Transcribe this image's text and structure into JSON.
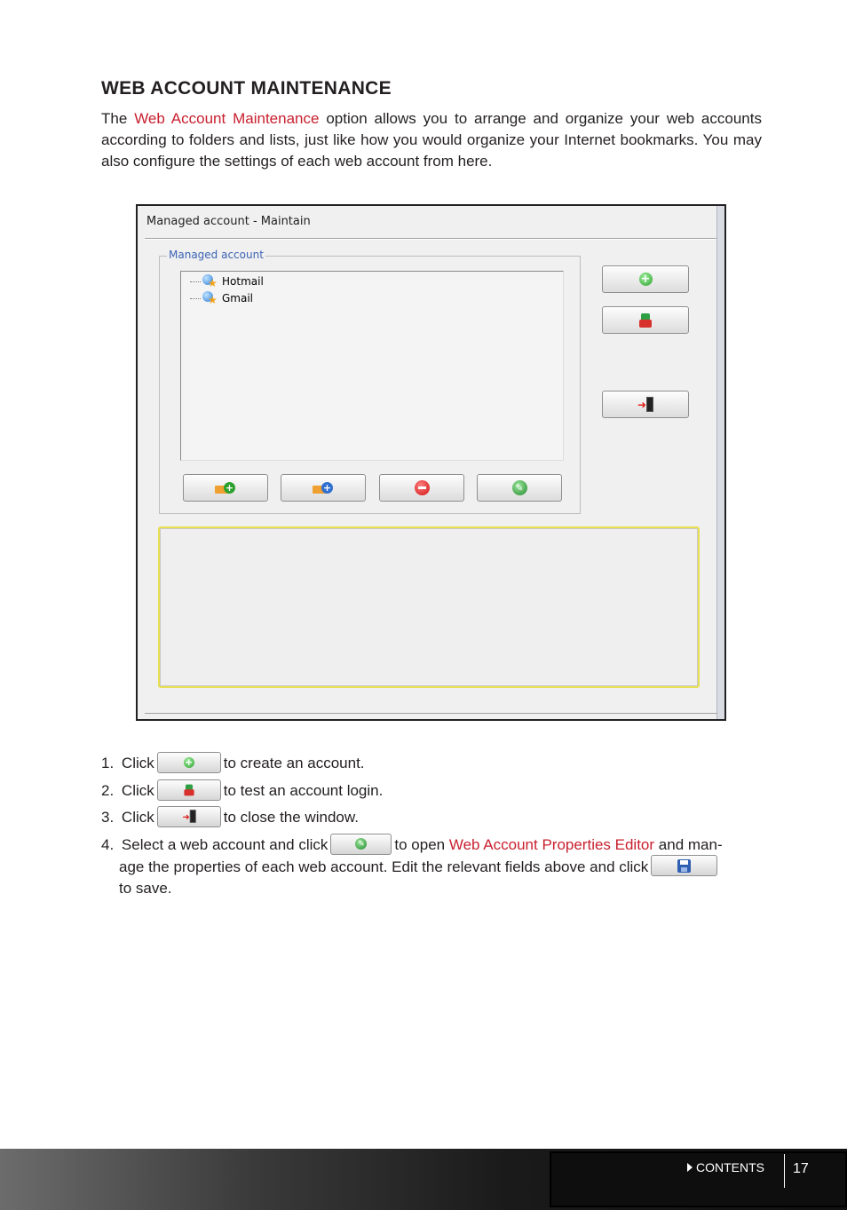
{
  "heading": "WEB ACCOUNT MAINTENANCE",
  "intro": {
    "prefix": "The ",
    "link": "Web Account Maintenance",
    "suffix": " option allows you to arrange and organize your web accounts according to folders and lists, just like how you would organize your Internet bookmarks. You may also configure the settings of each web account from here."
  },
  "window": {
    "title": "Managed  account - Maintain",
    "group_label": "Managed  account",
    "tree_items": [
      "Hotmail",
      "Gmail"
    ]
  },
  "steps": {
    "s1": {
      "num": "1.",
      "before": "Click",
      "after": "to create an account."
    },
    "s2": {
      "num": "2.",
      "before": "Click",
      "after": "to test an account login."
    },
    "s3": {
      "num": "3.",
      "before": "Click",
      "after": "to close the window."
    },
    "s4": {
      "num": "4.",
      "before": "Select a web account and click",
      "middle": "to open",
      "link": "Web Account Properties Editor",
      "after_link": "and man-",
      "line2_before": "age the properties of each web account. Edit the relevant fields above and click",
      "line3": "to save."
    }
  },
  "footer": {
    "contents": "CONTENTS",
    "page": "17"
  },
  "colors": {
    "link": "#c8202f",
    "text": "#231f20"
  }
}
